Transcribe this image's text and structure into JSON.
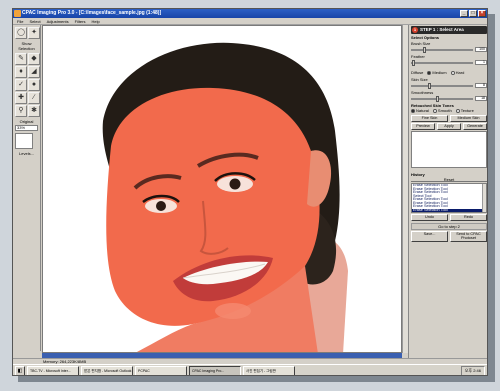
{
  "window": {
    "title": "CPAC Imaging Pro 3.0 - [C:\\Images\\face_sample.jpg (1:48)]",
    "controls": [
      "_",
      "□",
      "×"
    ]
  },
  "menu": [
    "File",
    "Select",
    "Adjustments",
    "Filters",
    "Help"
  ],
  "toolbox": {
    "show_selection": "Show Selection",
    "view_label": "Original",
    "zoom_value": "33%",
    "levels_label": "Levels..."
  },
  "panel": {
    "step_num": "1",
    "step_title": "STEP 1 : Select Area",
    "select_options": "Select Options",
    "brush_size_label": "Brush Size",
    "brush_size_value": "100",
    "feather_label": "Feather",
    "feather_value": "1",
    "diffuse_label": "Diffuse",
    "diffuse_options": [
      "Medium",
      "Hard"
    ],
    "skin_size_label": "Skin Size",
    "skin_size_value": "8",
    "smoothness_label": "Smoothness",
    "smoothness_value": "18",
    "retouched_label": "Retouched Skin Tones",
    "tone_options": [
      "Natural",
      "Smooth",
      "Texture"
    ],
    "fine_skin": "Fine Skin",
    "medium_skin": "Medium Skin",
    "preview": "Preview",
    "apply": "Apply",
    "generate": "Generate",
    "history_label": "History",
    "history_top": "Reset",
    "history_items": [
      "Erase Selection Tool",
      "Erase Selection Tool",
      "Erase Selection Tool",
      "Select Tool",
      "Erase Selection Tool",
      "Erase Selection Tool",
      "Erase Selection Tool",
      "Erase Selection Tool"
    ],
    "undo": "Undo",
    "redo": "Redo",
    "goto_step": "Go to step 2",
    "save": "Save...",
    "send": "Send to CPAC Photoset"
  },
  "status": {
    "memory": "Memory: 264,223K/8MB"
  },
  "taskbar": {
    "start": "◧",
    "tasks": [
      {
        "label": "TBC-TV - Microsoft Inter...",
        "active": false
      },
      {
        "label": "받은 편지함 - Microsoft Outlook",
        "active": false
      },
      {
        "label": "PCPAC",
        "active": false
      },
      {
        "label": "CPAC Imaging Pro...",
        "active": true
      },
      {
        "label": "사진 편집기 - 그림판",
        "active": false
      }
    ],
    "clock": "오후 2:46"
  },
  "colors": {
    "titlebar": "#1e4bb4",
    "skin_overlay": "#f26a4c",
    "hair": "#231c16",
    "step_header": "#2a2a2a",
    "history_selected": "#0a1c6b"
  }
}
